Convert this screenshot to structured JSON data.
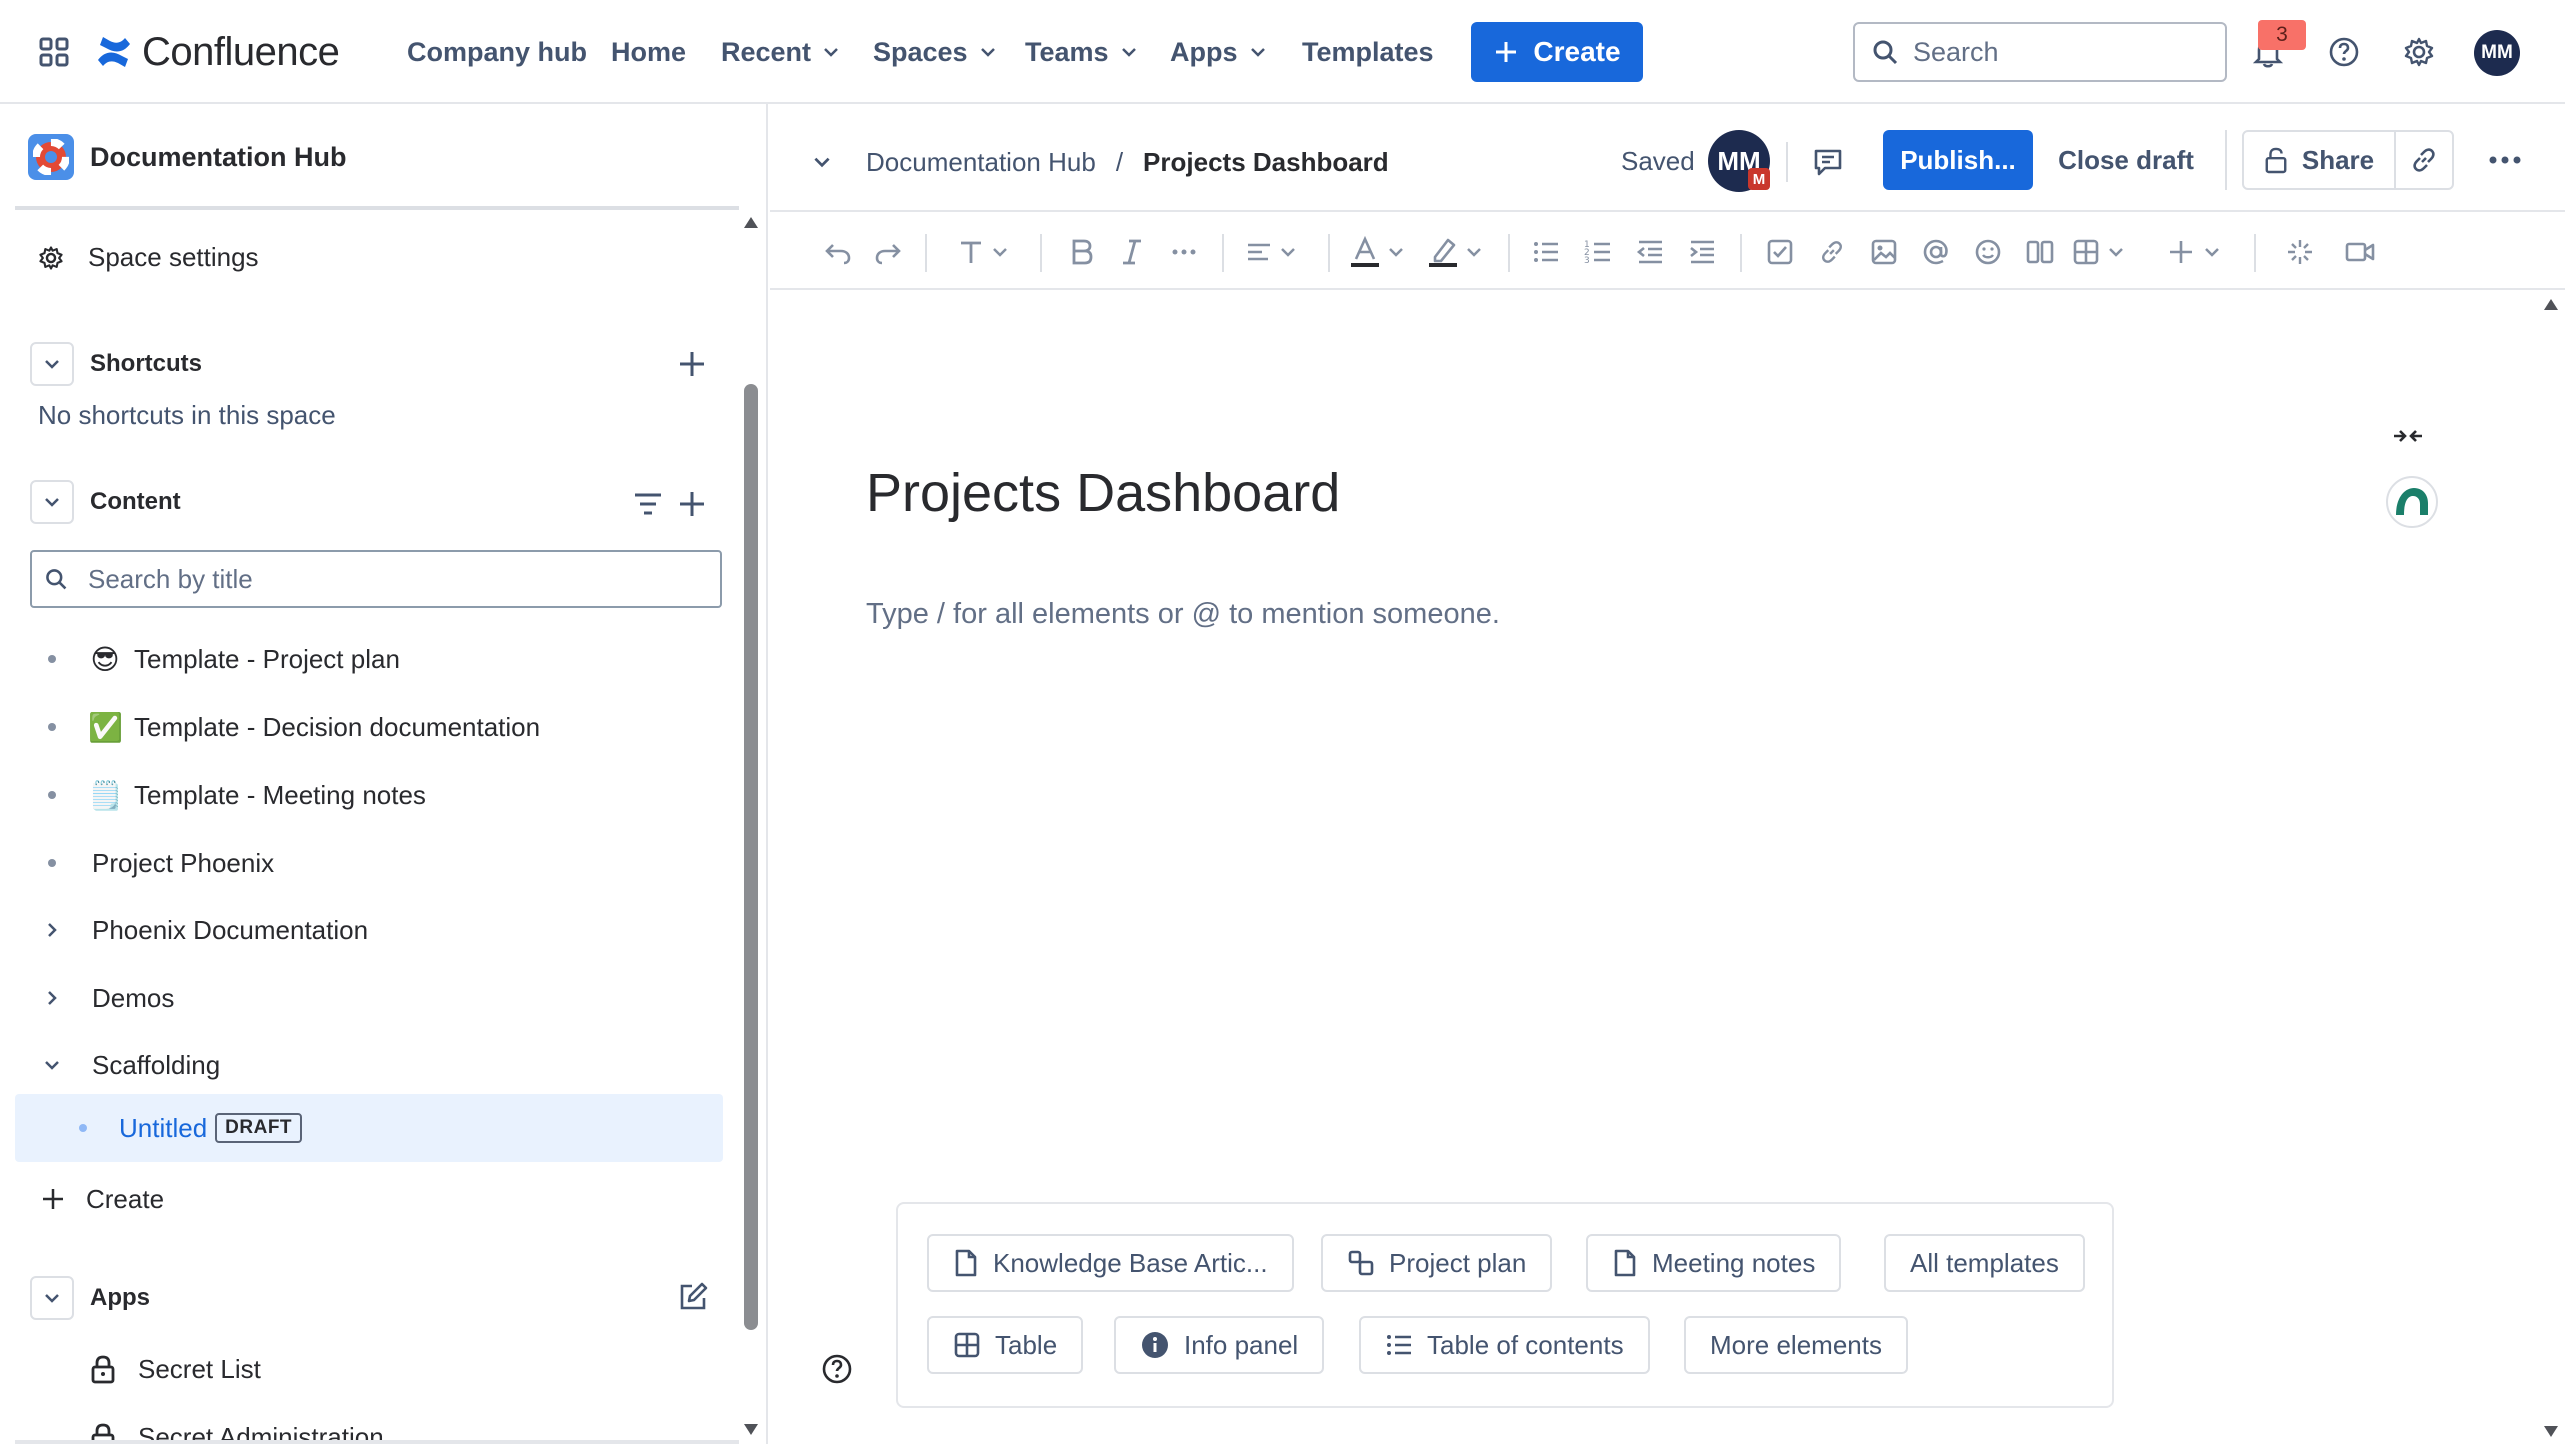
{
  "topnav": {
    "app_name": "Confluence",
    "items": [
      {
        "label": "Company hub",
        "dropdown": false
      },
      {
        "label": "Home",
        "dropdown": false
      },
      {
        "label": "Recent",
        "dropdown": true
      },
      {
        "label": "Spaces",
        "dropdown": true
      },
      {
        "label": "Teams",
        "dropdown": true
      },
      {
        "label": "Apps",
        "dropdown": true
      },
      {
        "label": "Templates",
        "dropdown": false
      }
    ],
    "create_label": "Create",
    "search_placeholder": "Search",
    "notification_count": "3",
    "avatar_initials": "MM",
    "accent": "#1868db"
  },
  "sidebar": {
    "space_name": "Documentation Hub",
    "space_settings": "Space settings",
    "shortcuts_heading": "Shortcuts",
    "shortcuts_empty": "No shortcuts in this space",
    "content_heading": "Content",
    "search_placeholder": "Search by title",
    "tree": [
      {
        "label": "Template - Project plan",
        "emoji": "😎"
      },
      {
        "label": "Template - Decision documentation",
        "emoji": "✅"
      },
      {
        "label": "Template - Meeting notes",
        "emoji": "🗒️"
      },
      {
        "label": "Project Phoenix"
      },
      {
        "label": "Phoenix Documentation"
      },
      {
        "label": "Demos"
      },
      {
        "label": "Scaffolding"
      },
      {
        "label": "Untitled",
        "badge": "DRAFT"
      }
    ],
    "create_label": "Create",
    "apps_heading": "Apps",
    "apps": [
      {
        "label": "Secret List"
      },
      {
        "label": "Secret Administration"
      }
    ]
  },
  "editor": {
    "breadcrumb_space": "Documentation Hub",
    "breadcrumb_separator": "/",
    "breadcrumb_page": "Projects Dashboard",
    "saved_label": "Saved",
    "collab_initials": "MM",
    "collab_badge": "M",
    "publish_label": "Publish...",
    "close_draft_label": "Close draft",
    "share_label": "Share",
    "page_title": "Projects Dashboard",
    "placeholder": "Type / for all elements or @ to mention someone.",
    "templates_row1": [
      "Knowledge Base Artic...",
      "Project plan",
      "Meeting notes",
      "All templates"
    ],
    "templates_row2": [
      "Table",
      "Info panel",
      "Table of contents",
      "More elements"
    ]
  }
}
